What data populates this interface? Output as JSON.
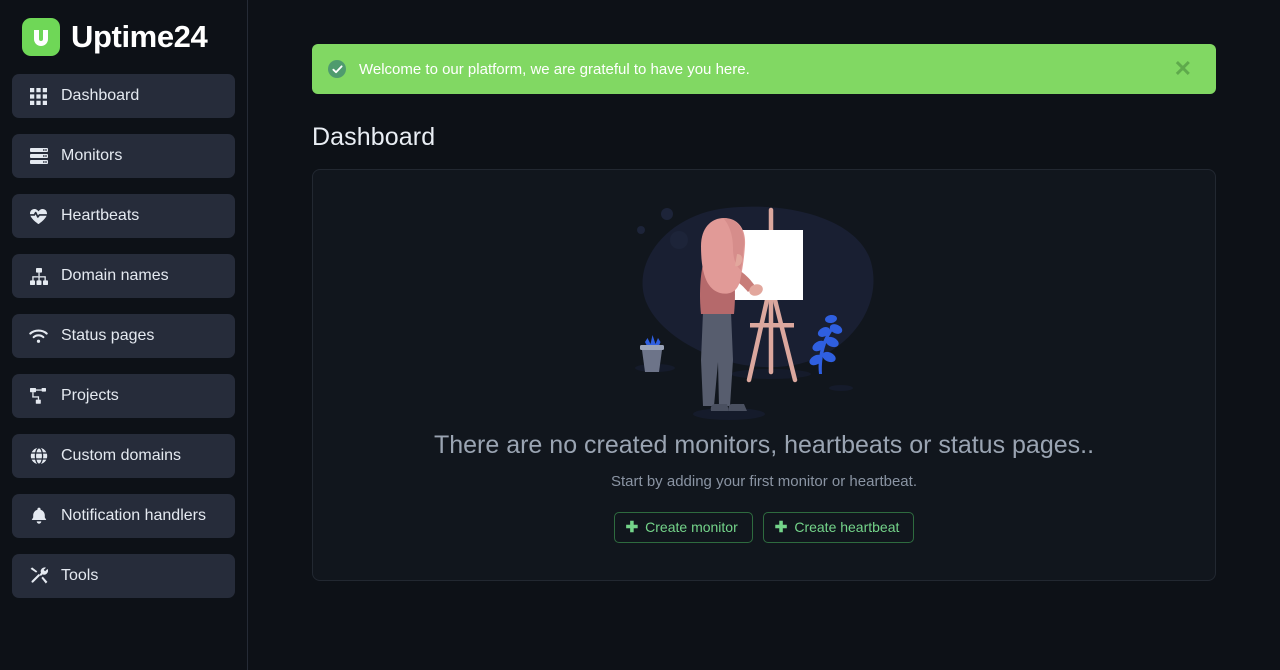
{
  "brand": {
    "name": "Uptime24",
    "logo_icon": "magnet-u-logo-icon",
    "logo_color": "#6fd757"
  },
  "sidebar": {
    "items": [
      {
        "label": "Dashboard",
        "icon": "grid-icon"
      },
      {
        "label": "Monitors",
        "icon": "server-stack-icon"
      },
      {
        "label": "Heartbeats",
        "icon": "heart-pulse-icon"
      },
      {
        "label": "Domain names",
        "icon": "sitemap-icon"
      },
      {
        "label": "Status pages",
        "icon": "wifi-icon"
      },
      {
        "label": "Projects",
        "icon": "project-diagram-icon"
      },
      {
        "label": "Custom domains",
        "icon": "globe-icon"
      },
      {
        "label": "Notification handlers",
        "icon": "bell-icon"
      },
      {
        "label": "Tools",
        "icon": "tools-icon"
      }
    ]
  },
  "alert": {
    "message": "Welcome to our platform, we are grateful to have you here.",
    "icon": "check-circle-icon",
    "close_label": "✕",
    "background_color": "#81d863",
    "text_color": "#ffffff"
  },
  "page": {
    "title": "Dashboard"
  },
  "empty_state": {
    "illustration": "person-painting-at-easel-illustration",
    "title": "There are no created monitors, heartbeats or status pages..",
    "subtitle": "Start by adding your first monitor or heartbeat.",
    "buttons": [
      {
        "label": "Create monitor",
        "icon": "plus-icon",
        "color": "#74d48a"
      },
      {
        "label": "Create heartbeat",
        "icon": "plus-icon",
        "color": "#74d48a"
      }
    ]
  }
}
